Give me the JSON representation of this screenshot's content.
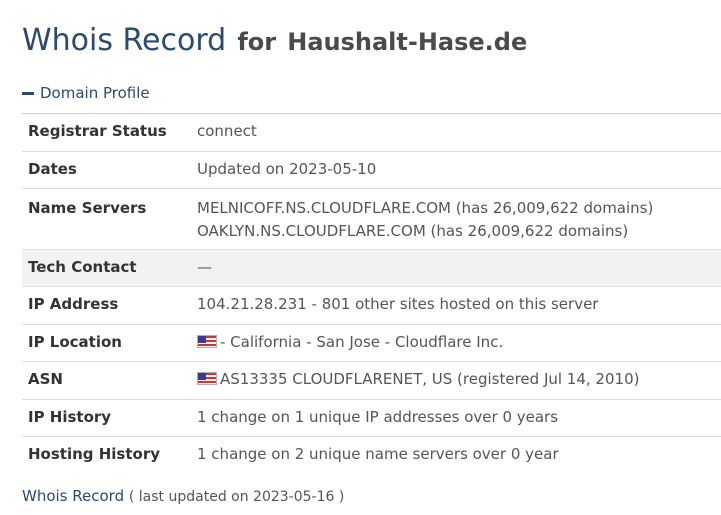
{
  "header": {
    "title_main": "Whois Record",
    "title_for": "for",
    "title_domain": "Haushalt-Hase.de"
  },
  "section": {
    "toggle_icon": "minus-icon",
    "label": "Domain Profile"
  },
  "profile": {
    "registrar_status": {
      "label": "Registrar Status",
      "value": "connect"
    },
    "dates": {
      "label": "Dates",
      "value": "Updated on 2023-05-10"
    },
    "name_servers": {
      "label": "Name Servers",
      "values": [
        "MELNICOFF.NS.CLOUDFLARE.COM (has 26,009,622 domains)",
        "OAKLYN.NS.CLOUDFLARE.COM (has 26,009,622 domains)"
      ]
    },
    "tech_contact": {
      "label": "Tech Contact",
      "value": "—"
    },
    "ip_address": {
      "label": "IP Address",
      "value": "104.21.28.231 - 801 other sites hosted on this server"
    },
    "ip_location": {
      "label": "IP Location",
      "flag_icon": "us-flag-icon",
      "value": "- California - San Jose - Cloudflare Inc."
    },
    "asn": {
      "label": "ASN",
      "flag_icon": "us-flag-icon",
      "value": "AS13335 CLOUDFLARENET, US (registered Jul 14, 2010)"
    },
    "ip_history": {
      "label": "IP History",
      "value": "1 change on 1 unique IP addresses over 0 years"
    },
    "hosting_history": {
      "label": "Hosting History",
      "value": "1 change on 2 unique name servers over 0 year"
    }
  },
  "footer": {
    "link": "Whois Record",
    "note": "( last updated on 2023-05-16 )"
  },
  "colors": {
    "accent": "#2b4a6e",
    "row_highlight": "#f2f2f2",
    "text": "#555555"
  }
}
